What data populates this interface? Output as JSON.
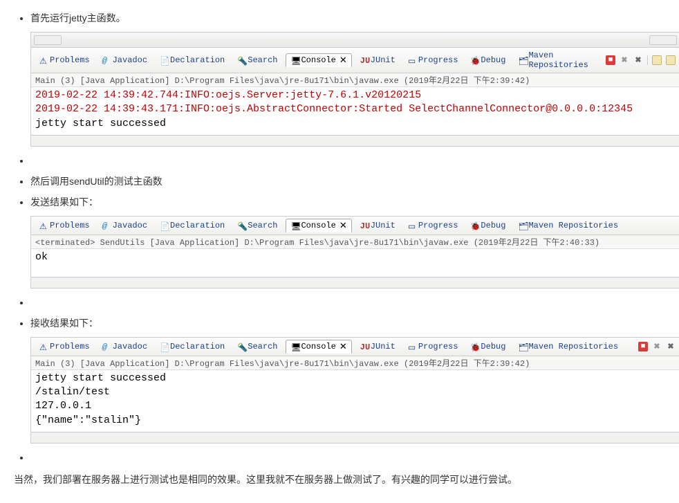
{
  "bullets": [
    {
      "text": "首先运行jetty主函数。"
    },
    {
      "text": ""
    },
    {
      "text": "然后调用sendUtil的测试主函数"
    },
    {
      "text": "发送结果如下："
    },
    {
      "text": ""
    },
    {
      "text": "接收结果如下："
    },
    {
      "text": ""
    }
  ],
  "tabs": {
    "problems": "Problems",
    "javadoc": "Javadoc",
    "declaration": "Declaration",
    "search": "Search",
    "console": "Console",
    "junit": "JUnit",
    "progress": "Progress",
    "debug": "Debug",
    "maven": "Maven Repositories"
  },
  "icons": {
    "problems": "⚠",
    "javadoc": "@",
    "declaration": "📄",
    "search": "🔦",
    "console": "🖥",
    "consoleX": "✕",
    "junit": "JU",
    "progress": "▭",
    "debug": "🐞",
    "maven": "🗂"
  },
  "shot1": {
    "info": "Main (3) [Java Application] D:\\Program Files\\java\\jre-8u171\\bin\\javaw.exe (2019年2月22日 下午2:39:42)",
    "l1": "2019-02-22 14:39:42.744:INFO:oejs.Server:jetty-7.6.1.v20120215",
    "l2": "2019-02-22 14:39:43.171:INFO:oejs.AbstractConnector:Started SelectChannelConnector@0.0.0.0:12345",
    "l3": "jetty start successed"
  },
  "shot2": {
    "info": "<terminated> SendUtils [Java Application] D:\\Program Files\\java\\jre-8u171\\bin\\javaw.exe (2019年2月22日 下午2:40:33)",
    "l1": "ok"
  },
  "shot3": {
    "info": "Main (3) [Java Application] D:\\Program Files\\java\\jre-8u171\\bin\\javaw.exe (2019年2月22日 下午2:39:42)",
    "l1": "jetty start successed",
    "l2": "/stalin/test",
    "l3": "127.0.0.1",
    "l4": "{\"name\":\"stalin\"}"
  },
  "footer": "当然，我们部署在服务器上进行测试也是相同的效果。这里我就不在服务器上做测试了。有兴趣的同学可以进行尝试。"
}
